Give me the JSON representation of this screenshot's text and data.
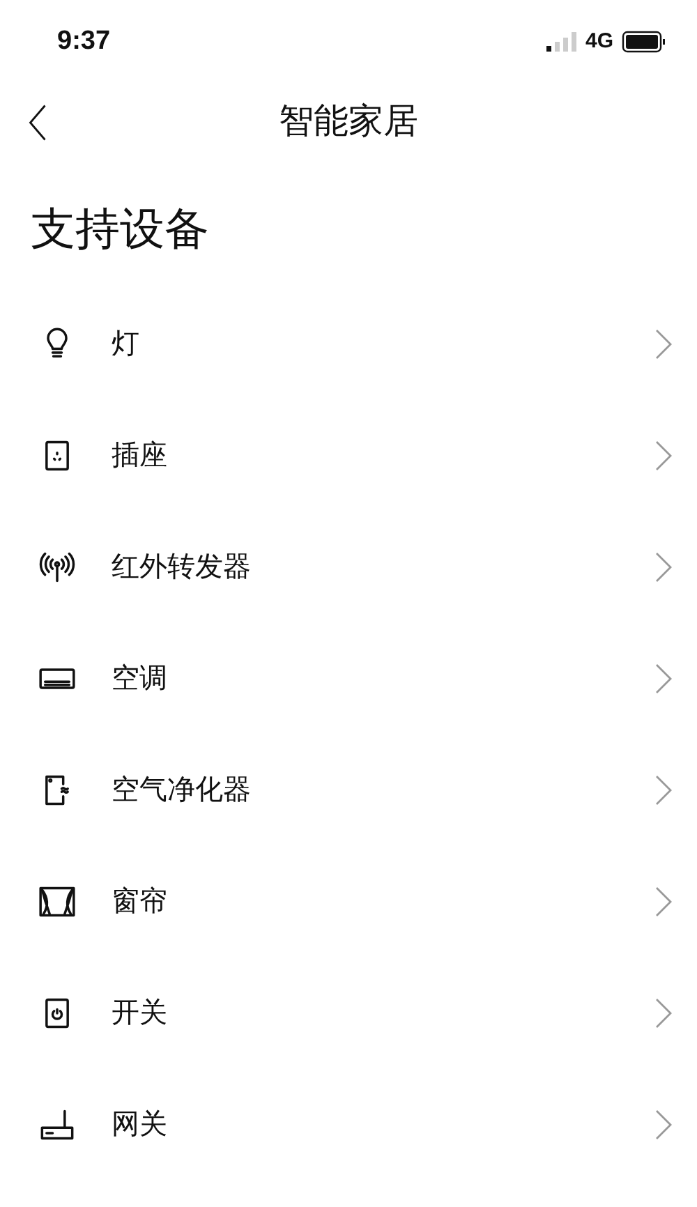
{
  "status_bar": {
    "time": "9:37",
    "network": "4G"
  },
  "nav": {
    "title": "智能家居"
  },
  "section_title": "支持设备",
  "devices": [
    {
      "kind": "bulb",
      "name": "灯"
    },
    {
      "kind": "socket",
      "name": "插座"
    },
    {
      "kind": "infrared",
      "name": "红外转发器"
    },
    {
      "kind": "aircon",
      "name": "空调"
    },
    {
      "kind": "purifier",
      "name": "空气净化器"
    },
    {
      "kind": "curtain",
      "name": "窗帘"
    },
    {
      "kind": "switch",
      "name": "开关"
    },
    {
      "kind": "gateway",
      "name": "网关"
    }
  ]
}
